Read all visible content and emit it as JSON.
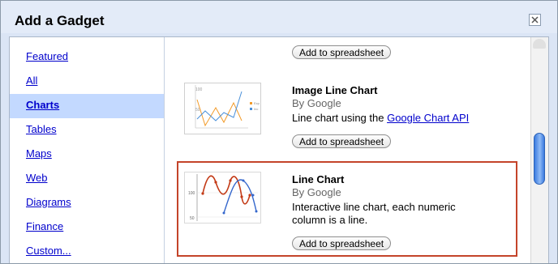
{
  "dialog": {
    "title": "Add a Gadget",
    "close_icon": "close-x-icon"
  },
  "sidebar": {
    "items": [
      {
        "label": "Featured",
        "selected": false
      },
      {
        "label": "All",
        "selected": false
      },
      {
        "label": "Charts",
        "selected": true
      },
      {
        "label": "Tables",
        "selected": false
      },
      {
        "label": "Maps",
        "selected": false
      },
      {
        "label": "Web",
        "selected": false
      },
      {
        "label": "Diagrams",
        "selected": false
      },
      {
        "label": "Finance",
        "selected": false
      },
      {
        "label": "Custom...",
        "selected": false
      }
    ]
  },
  "gadgets": {
    "add_label": "Add to spreadsheet",
    "items": [
      {
        "name": "Image Line Chart",
        "by": "By Google",
        "desc_prefix": "Line chart using the ",
        "desc_link": "Google Chart API",
        "thumb_ticks": [
          "100",
          "50"
        ],
        "thumb_legend": [
          "Exp",
          "Inc"
        ]
      },
      {
        "name": "Line Chart",
        "by": "By Google",
        "desc": "Interactive line chart, each numeric column is a line.",
        "thumb_ticks": [
          "100",
          "50"
        ]
      }
    ]
  },
  "colors": {
    "selected_bg": "#c3d9ff",
    "link": "#0000cc",
    "highlight_border": "#c4442a",
    "series_orange": "#f29b2a",
    "series_blue": "#4a90d9",
    "series_red": "#c33a16",
    "series_darkblue": "#3366cc"
  }
}
